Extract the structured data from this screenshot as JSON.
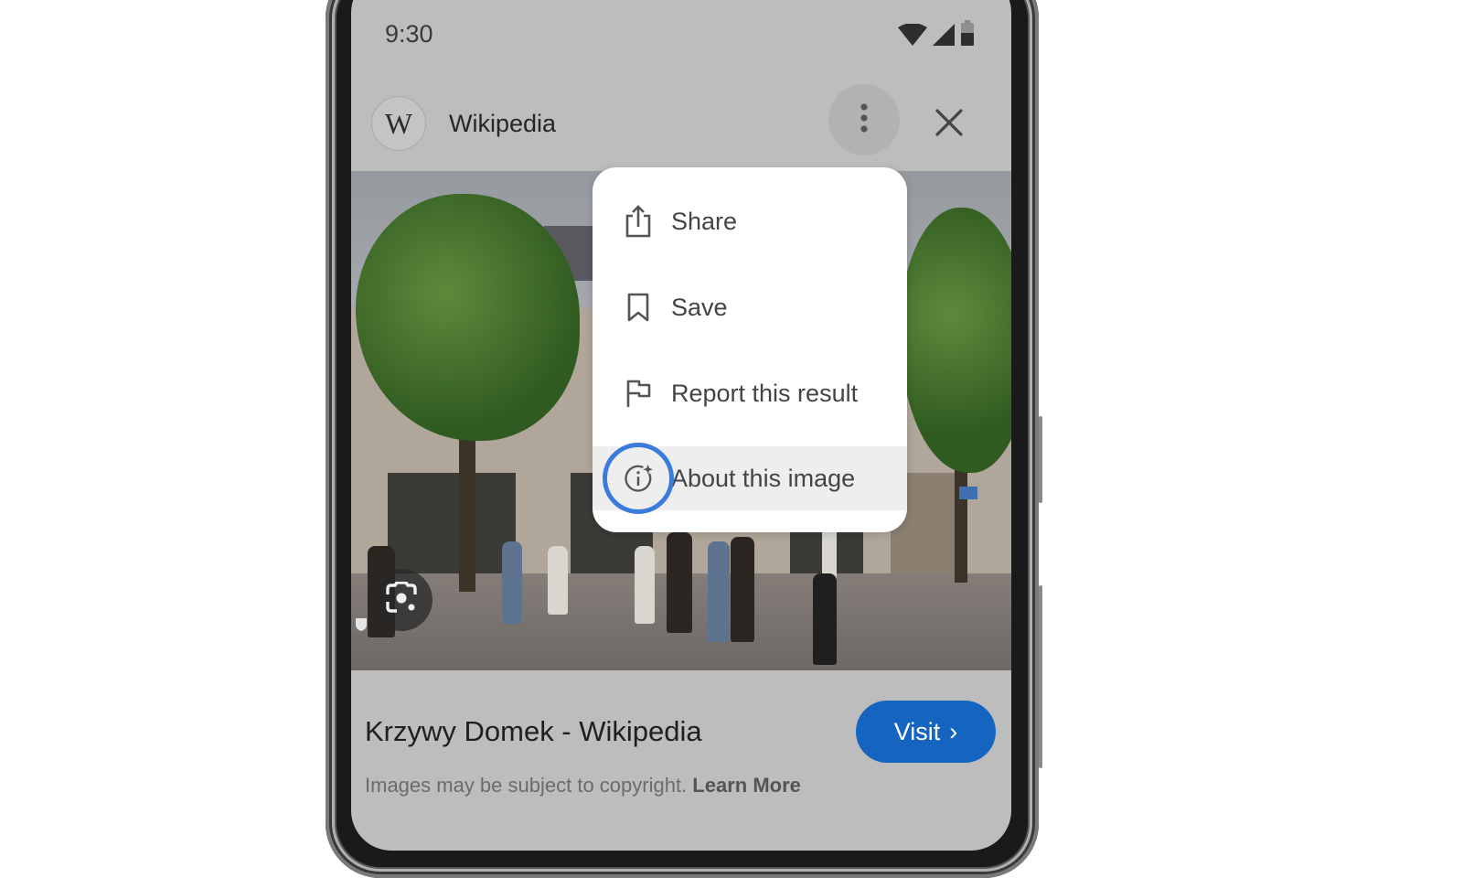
{
  "status_bar": {
    "time": "9:30",
    "icons": [
      "wifi-icon",
      "cellular-signal-icon",
      "battery-icon"
    ]
  },
  "header": {
    "site_logo_letter": "W",
    "site_name": "Wikipedia",
    "more_options_icon": "more-vert-icon",
    "close_icon": "close-icon"
  },
  "image": {
    "description": "Photo of Krzywy Domek (Crooked House) street scene with trees and pedestrians",
    "lens_icon": "google-lens-icon"
  },
  "menu": {
    "items": [
      {
        "label": "Share",
        "icon": "share-icon"
      },
      {
        "label": "Save",
        "icon": "bookmark-icon"
      },
      {
        "label": "Report this result",
        "icon": "flag-icon"
      },
      {
        "label": "About this image",
        "icon": "info-sparkle-icon",
        "highlighted": true
      }
    ]
  },
  "result": {
    "title": "Krzywy Domek - Wikipedia",
    "visit_label": "Visit",
    "visit_chevron": "›",
    "copyright_text": "Images may be subject to copyright.",
    "learn_more_label": "Learn More"
  },
  "colors": {
    "accent_blue": "#1565c0",
    "focus_ring": "#3b7bdc",
    "screen_dim_bg": "#bdbdbd",
    "menu_bg": "#ffffff"
  }
}
